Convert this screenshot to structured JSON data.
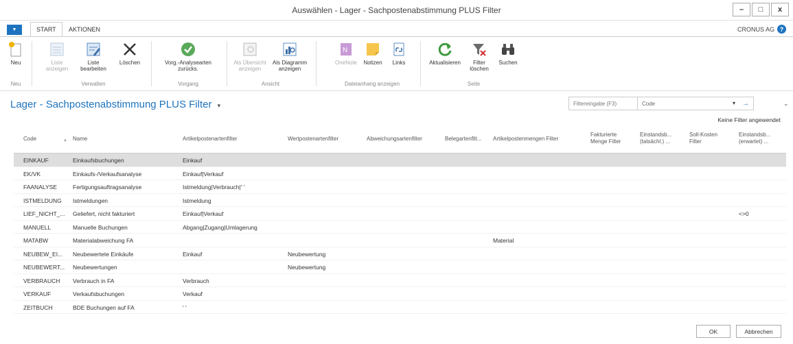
{
  "window": {
    "title": "Auswählen - Lager - Sachpostenabstimmung PLUS Filter",
    "min": "–",
    "max": "□",
    "close": "x"
  },
  "tabs": {
    "menu": "▼",
    "start": "START",
    "aktionen": "AKTIONEN"
  },
  "company": {
    "name": "CRONUS AG",
    "help": "?"
  },
  "ribbon": {
    "neu": "Neu",
    "liste_anzeigen": "Liste anzeigen",
    "liste_bearbeiten": "Liste bearbeiten",
    "loeschen": "Löschen",
    "vorg_reset": "Vorg.-Analysearten zurücks.",
    "als_uebersicht": "Als Übersicht anzeigen",
    "als_diagramm": "Als Diagramm anzeigen",
    "onenote": "OneNote",
    "notizen": "Notizen",
    "links": "Links",
    "aktualisieren": "Aktualisieren",
    "filter_loeschen": "Filter löschen",
    "suchen": "Suchen",
    "groups": {
      "neu": "Neu",
      "verwalten": "Verwalten",
      "vorgang": "Vorgang",
      "ansicht": "Ansicht",
      "dateianhang": "Dateianhang anzeigen",
      "seite": "Seite"
    }
  },
  "page": {
    "title": "Lager - Sachpostenabstimmung PLUS Filter",
    "title_caret": "▾"
  },
  "filter": {
    "placeholder": "Filtereingabe (F3)",
    "field": "Code",
    "dropdown": "▾",
    "go": "→",
    "chevron": "⌄",
    "status": "Keine Filter angewendet"
  },
  "table": {
    "headers": {
      "code": "Code",
      "sort": "▲",
      "name": "Name",
      "artikel": "Artikelpostenartenfilter",
      "wert": "Wertpostenartenfilter",
      "abw": "Abweichungsartenfilter",
      "beleg": "Belegartenfilt...",
      "menge": "Artikelpostenmengen Filter",
      "fakt": "Fakturierte Menge Filter",
      "einst1": "Einstandsb... (tatsächl.) ...",
      "soll": "Soll-Kosten Filter",
      "einst2": "Einstandsb... (erwartet) ..."
    },
    "rows": [
      {
        "code": "EINKAUF",
        "name": "Einkaufsbuchungen",
        "artikel": "Einkauf",
        "wert": "",
        "menge": "",
        "einst2": ""
      },
      {
        "code": "EK/VK",
        "name": "Einkaufs-/Verkaufsanalyse",
        "artikel": "Einkauf|Verkauf",
        "wert": "",
        "menge": "",
        "einst2": ""
      },
      {
        "code": "FAANALYSE",
        "name": "Fertigungsauftragsanalyse",
        "artikel": "Istmeldung|Verbrauch|' '",
        "wert": "",
        "menge": "",
        "einst2": ""
      },
      {
        "code": "ISTMELDUNG",
        "name": "Istmeldungen",
        "artikel": "Istmeldung",
        "wert": "",
        "menge": "",
        "einst2": ""
      },
      {
        "code": "LIEF_NICHT_...",
        "name": "Geliefert, nicht fakturiert",
        "artikel": "Einkauf|Verkauf",
        "wert": "",
        "menge": "",
        "einst2": "<>0"
      },
      {
        "code": "MANUELL",
        "name": "Manuelle Buchungen",
        "artikel": "Abgang|Zugang|Umlagerung",
        "wert": "",
        "menge": "",
        "einst2": ""
      },
      {
        "code": "MATABW",
        "name": "Materialabweichung FA",
        "artikel": "",
        "wert": "",
        "menge": "Material",
        "einst2": ""
      },
      {
        "code": "NEUBEW_EI...",
        "name": "Neubewertete Einkäufe",
        "artikel": "Einkauf",
        "wert": "Neubewertung",
        "menge": "",
        "einst2": ""
      },
      {
        "code": "NEUBEWERT...",
        "name": "Neubewertungen",
        "artikel": "",
        "wert": "Neubewertung",
        "menge": "",
        "einst2": ""
      },
      {
        "code": "VERBRAUCH",
        "name": "Verbrauch in FA",
        "artikel": "Verbrauch",
        "wert": "",
        "menge": "",
        "einst2": ""
      },
      {
        "code": "VERKAUF",
        "name": "Verkaufsbuchungen",
        "artikel": "Verkauf",
        "wert": "",
        "menge": "",
        "einst2": ""
      },
      {
        "code": "ZEITBUCH",
        "name": "BDE Buchungen auf FA",
        "artikel": "' '",
        "wert": "",
        "menge": "",
        "einst2": ""
      }
    ]
  },
  "buttons": {
    "ok": "OK",
    "cancel": "Abbrechen"
  },
  "colors": {
    "accent": "#1e73be",
    "selected_row": "#dedede"
  }
}
